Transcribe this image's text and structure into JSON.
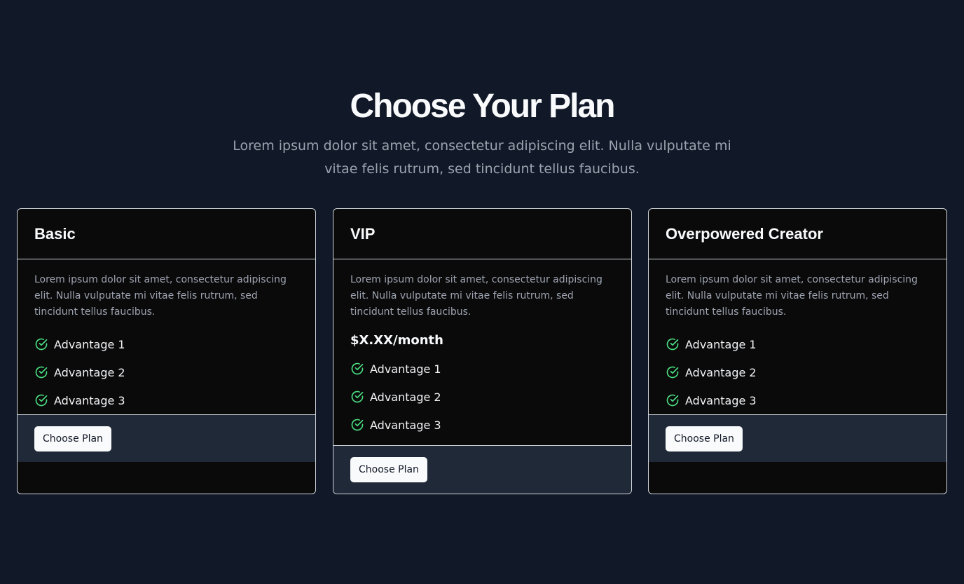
{
  "hero": {
    "title": "Choose Your Plan",
    "subtitle": "Lorem ipsum dolor sit amet, consectetur adipiscing elit. Nulla vulputate mi vitae felis rutrum, sed tincidunt tellus faucibus."
  },
  "plans": [
    {
      "name": "Basic",
      "description": "Lorem ipsum dolor sit amet, consectetur adipiscing elit. Nulla vulputate mi vitae felis rutrum, sed tincidunt tellus faucibus.",
      "features": [
        "Advantage 1",
        "Advantage 2",
        "Advantage 3"
      ],
      "button_label": "Choose Plan"
    },
    {
      "name": "VIP",
      "description": "Lorem ipsum dolor sit amet, consectetur adipiscing elit. Nulla vulputate mi vitae felis rutrum, sed tincidunt tellus faucibus.",
      "price": "$X.XX/month",
      "features": [
        "Advantage 1",
        "Advantage 2",
        "Advantage 3"
      ],
      "button_label": "Choose Plan"
    },
    {
      "name": "Overpowered Creator",
      "description": "Lorem ipsum dolor sit amet, consectetur adipiscing elit. Nulla vulputate mi vitae felis rutrum, sed tincidunt tellus faucibus.",
      "features": [
        "Advantage 1",
        "Advantage 2",
        "Advantage 3"
      ],
      "button_label": "Choose Plan"
    }
  ],
  "icons": {
    "feature": "check-circle-icon"
  },
  "colors": {
    "background": "#111827",
    "card_background": "#0a0a0b",
    "footer_background": "#1f2937",
    "check_green": "#4ade80",
    "text_muted": "#9ca3af"
  }
}
